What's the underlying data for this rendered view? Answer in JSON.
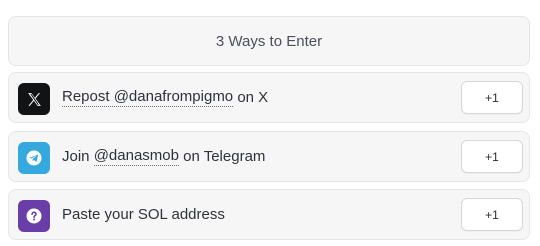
{
  "header": {
    "title": "3 Ways to Enter"
  },
  "entries": [
    {
      "icon": "x-logo-icon",
      "prefix": "Repost ",
      "handle": "@danafrompigmo",
      "suffix": " on X",
      "label": "Repost @danafrompigmo on X",
      "button": "+1"
    },
    {
      "icon": "telegram-icon",
      "prefix": "Join ",
      "handle": "@danasmob",
      "suffix": " on Telegram",
      "label": "Join @danasmob on Telegram",
      "button": "+1"
    },
    {
      "icon": "question-mark-icon",
      "label": "Paste your SOL address",
      "button": "+1"
    }
  ],
  "colors": {
    "x_icon_bg": "#111315",
    "telegram_icon_bg": "#35a9dd",
    "question_icon_bg": "#6a3ea8"
  }
}
